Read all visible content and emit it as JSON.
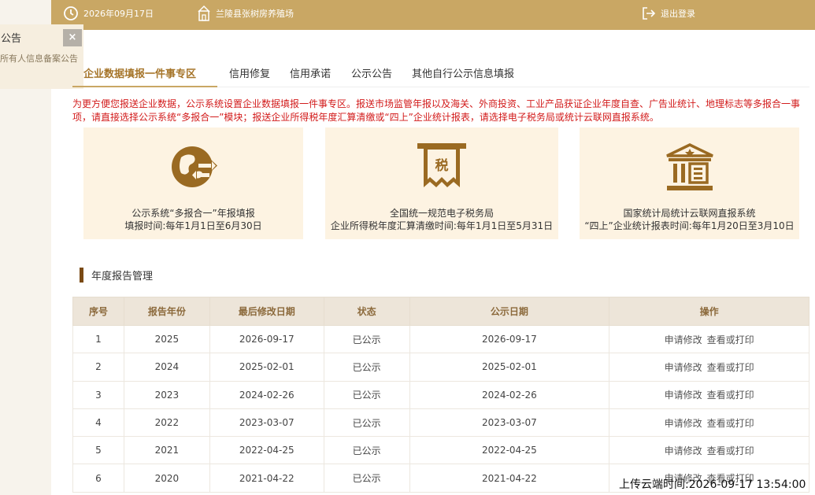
{
  "topbar": {
    "date": "2026年09月17日",
    "farm": "兰陵县张树房养殖场",
    "logout": "退出登录"
  },
  "notice": {
    "title": "公告",
    "close": "×",
    "text": "所有人信息备案公告"
  },
  "tabs": [
    {
      "label": "企业数据填报一件事专区",
      "active": true
    },
    {
      "label": "信用修复"
    },
    {
      "label": "信用承诺"
    },
    {
      "label": "公示公告"
    },
    {
      "label": "其他自行公示信息填报"
    }
  ],
  "red_notice": "为更方便您报送企业数据，公示系统设置企业数据填报一件事专区。报送市场监管年报以及海关、外商投资、工业产品获证企业年度自查、广告业统计、地理标志等多报合一事项，请直接选择公示系统“多报合一”模块；报送企业所得税年度汇算清缴或“四上”企业统计报表，请选择电子税务局或统计云联网直报系统。",
  "cards": [
    {
      "icon": "globe-exchange-icon",
      "line1": "公示系统“多报合一”年报填报",
      "line2": "填报时间:每年1月1日至6月30日"
    },
    {
      "icon": "tax-receipt-icon",
      "line1": "全国统一规范电子税务局",
      "line2": "企业所得税年度汇算清缴时间:每年1月1日至5月31日"
    },
    {
      "icon": "government-building-icon",
      "line1": "国家统计局统计云联网直报系统",
      "line2": "“四上”企业统计报表时间:每年1月20日至3月10日"
    }
  ],
  "section_title": "年度报告管理",
  "table": {
    "headers": [
      "序号",
      "报告年份",
      "最后修改日期",
      "状态",
      "公示日期",
      "操作"
    ],
    "rows": [
      {
        "no": "1",
        "year": "2025",
        "modified": "2026-09-17",
        "status": "已公示",
        "published": "2026-09-17"
      },
      {
        "no": "2",
        "year": "2024",
        "modified": "2025-02-01",
        "status": "已公示",
        "published": "2025-02-01"
      },
      {
        "no": "3",
        "year": "2023",
        "modified": "2024-02-26",
        "status": "已公示",
        "published": "2024-02-26"
      },
      {
        "no": "4",
        "year": "2022",
        "modified": "2023-03-07",
        "status": "已公示",
        "published": "2023-03-07"
      },
      {
        "no": "5",
        "year": "2021",
        "modified": "2022-04-25",
        "status": "已公示",
        "published": "2022-04-25"
      },
      {
        "no": "6",
        "year": "2020",
        "modified": "2021-04-22",
        "status": "已公示",
        "published": "2021-04-22"
      }
    ],
    "op_modify": "申请修改",
    "op_view": "查看或打印"
  },
  "stamp": "上传云端时间:2026-09-17 13:54:00",
  "colors": {
    "topbar": "#c9a764",
    "card_bg": "#fdf3e2",
    "icon_brown": "#9a6a22",
    "notice_red": "#d21a1a",
    "table_header_bg": "#ede5d9"
  }
}
